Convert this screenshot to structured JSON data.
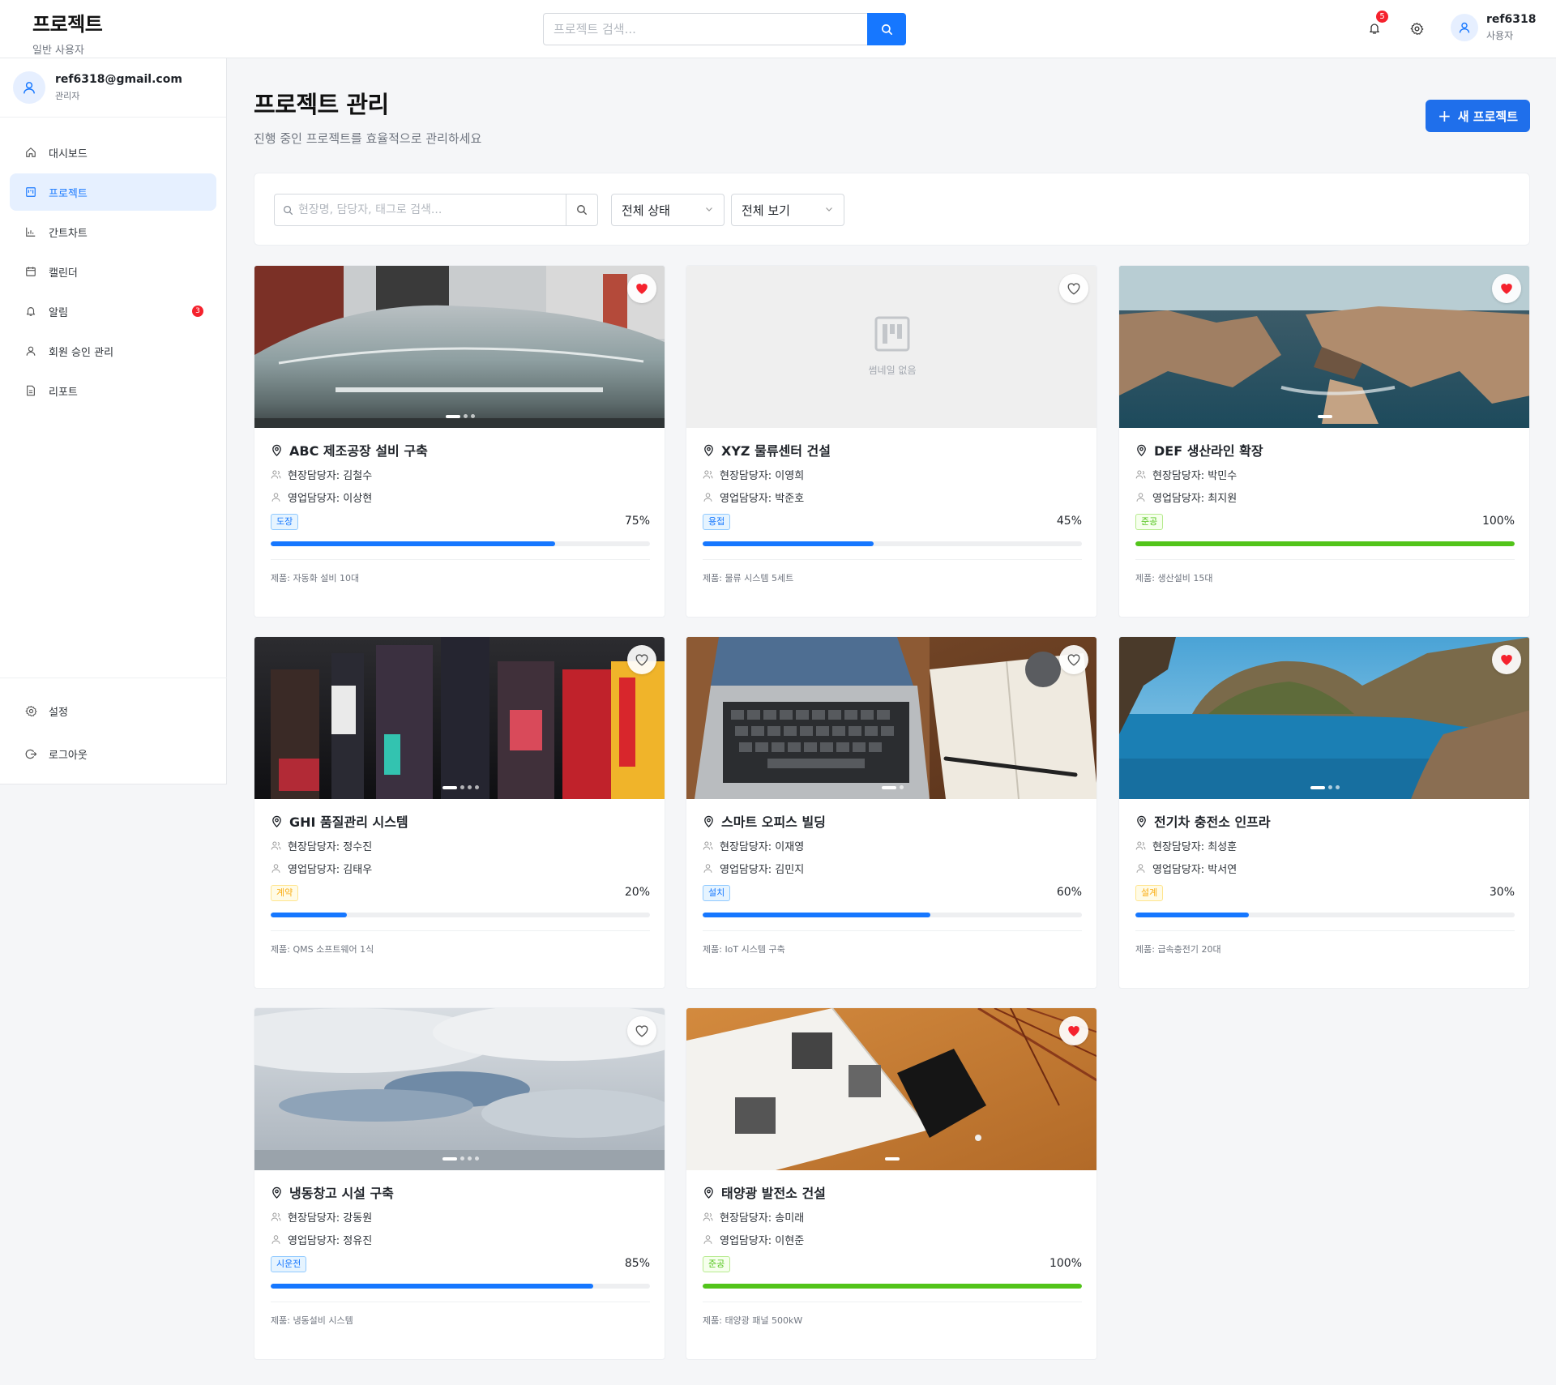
{
  "header": {
    "title": "프로젝트",
    "subtitle": "일반 사용자",
    "search_placeholder": "프로젝트 검색...",
    "notification_count": "5",
    "user_name": "ref6318",
    "user_role": "사용자"
  },
  "sidebar": {
    "user_email": "ref6318@gmail.com",
    "user_role": "관리자",
    "items": [
      {
        "label": "대시보드",
        "icon": "home-icon"
      },
      {
        "label": "프로젝트",
        "icon": "project-icon",
        "active": true
      },
      {
        "label": "간트차트",
        "icon": "chart-icon"
      },
      {
        "label": "캘린더",
        "icon": "calendar-icon"
      },
      {
        "label": "알림",
        "icon": "bell-icon",
        "badge": "3"
      },
      {
        "label": "회원 승인 관리",
        "icon": "user-icon"
      },
      {
        "label": "리포트",
        "icon": "report-icon"
      }
    ],
    "bottom_items": [
      {
        "label": "설정",
        "icon": "gear-icon"
      },
      {
        "label": "로그아웃",
        "icon": "logout-icon"
      }
    ]
  },
  "main": {
    "title": "프로젝트 관리",
    "subtitle": "진행 중인 프로젝트를 효율적으로 관리하세요",
    "new_button": "새 프로젝트",
    "filter": {
      "search_placeholder": "현장명, 담당자, 태그로 검색...",
      "status_select": "전체 상태",
      "view_select": "전체 보기"
    }
  },
  "colors": {
    "accent": "#1677ff",
    "complete": "#52c41a",
    "favorite": "#f5222d"
  },
  "projects": [
    {
      "title": "ABC 제조공장 설비 구축",
      "site_manager": "현장담당자: 김철수",
      "sales_manager": "영업담당자: 이상현",
      "status": "도장",
      "status_color": "blue",
      "progress": 75,
      "progress_label": "75%",
      "product": "제품: 자동화 설비 10대",
      "favorite": true,
      "thumbnail": "photo-vintage-car",
      "slide_count": 3
    },
    {
      "title": "XYZ 물류센터 건설",
      "site_manager": "현장담당자: 이영희",
      "sales_manager": "영업담당자: 박준호",
      "status": "용접",
      "status_color": "blue",
      "progress": 45,
      "progress_label": "45%",
      "product": "제품: 물류 시스템 5세트",
      "favorite": false,
      "thumbnail": "none",
      "no_thumbnail_label": "썸네일 없음",
      "slide_count": 0
    },
    {
      "title": "DEF 생산라인 확장",
      "site_manager": "현장담당자: 박민수",
      "sales_manager": "영업담당자: 최지원",
      "status": "준공",
      "status_color": "green",
      "progress": 100,
      "progress_label": "100%",
      "product": "제품: 생산설비 15대",
      "favorite": true,
      "thumbnail": "photo-coastal-cliffs",
      "slide_count": 1
    },
    {
      "title": "GHI 품질관리 시스템",
      "site_manager": "현장담당자: 정수진",
      "sales_manager": "영업담당자: 김태우",
      "status": "계약",
      "status_color": "gold",
      "progress": 20,
      "progress_label": "20%",
      "product": "제품: QMS 소프트웨어 1식",
      "favorite": false,
      "thumbnail": "photo-city-night-signs",
      "slide_count": 4
    },
    {
      "title": "스마트 오피스 빌딩",
      "site_manager": "현장담당자: 이재영",
      "sales_manager": "영업담당자: 김민지",
      "status": "설치",
      "status_color": "blue",
      "progress": 60,
      "progress_label": "60%",
      "product": "제품: IoT 시스템 구축",
      "favorite": false,
      "thumbnail": "photo-laptop-notebook",
      "slide_count": 2
    },
    {
      "title": "전기차 충전소 인프라",
      "site_manager": "현장담당자: 최성훈",
      "sales_manager": "영업담당자: 박서연",
      "status": "설계",
      "status_color": "gold",
      "progress": 30,
      "progress_label": "30%",
      "product": "제품: 급속충전기 20대",
      "favorite": true,
      "thumbnail": "photo-sea-cliffs",
      "slide_count": 3
    },
    {
      "title": "냉동창고 시설 구축",
      "site_manager": "현장담당자: 강동원",
      "sales_manager": "영업담당자: 정유진",
      "status": "시운전",
      "status_color": "blue",
      "progress": 85,
      "progress_label": "85%",
      "product": "제품: 냉동설비 시스템",
      "favorite": false,
      "thumbnail": "photo-cloudy-sky",
      "slide_count": 4
    },
    {
      "title": "태양광 발전소 건설",
      "site_manager": "현장담당자: 송미래",
      "sales_manager": "영업담당자: 이현준",
      "status": "준공",
      "status_color": "green",
      "progress": 100,
      "progress_label": "100%",
      "product": "제품: 태양광 패널 500kW",
      "favorite": true,
      "thumbnail": "photo-magazine-desk",
      "slide_count": 1
    }
  ]
}
